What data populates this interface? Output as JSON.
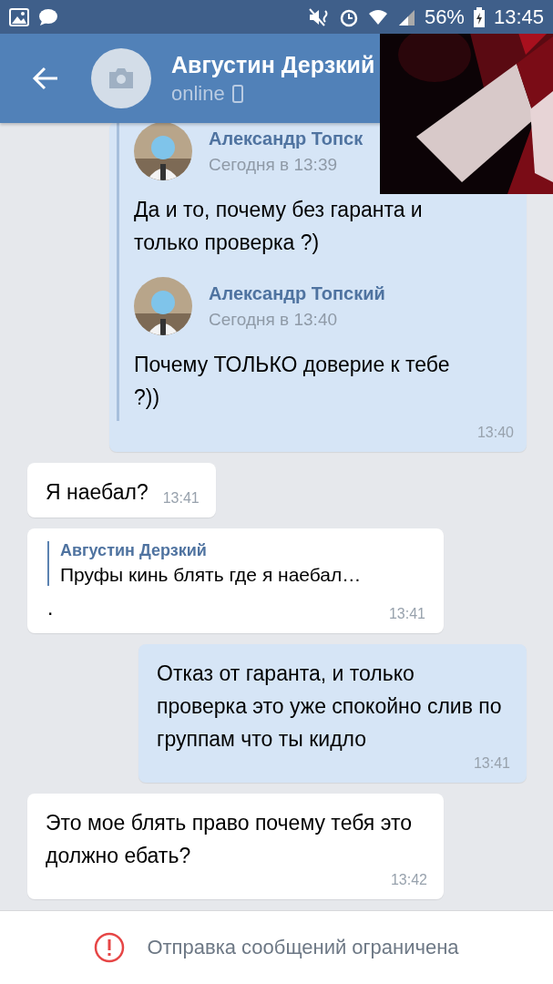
{
  "status_bar": {
    "battery": "56%",
    "time": "13:45"
  },
  "header": {
    "title": "Августин Дерзкий",
    "subtitle": "online"
  },
  "messages": [
    {
      "kind": "forwarded",
      "outgoing": true,
      "forwarded": [
        {
          "author": "Александр Топск",
          "date": "Сегодня в 13:39",
          "text": "Да и то, почему без гаранта и только проверка ?)"
        },
        {
          "author": "Александр Топский",
          "date": "Сегодня в 13:40",
          "text": "Почему ТОЛЬКО доверие к тебе ?))"
        }
      ],
      "time": "13:40"
    },
    {
      "kind": "text",
      "outgoing": false,
      "text": "Я наебал?",
      "time": "13:41"
    },
    {
      "kind": "reply",
      "outgoing": false,
      "reply": {
        "author": "Августин Дерзкий",
        "text": "Пруфы кинь блять где я наебал…"
      },
      "text": ".",
      "time": "13:41"
    },
    {
      "kind": "text",
      "outgoing": true,
      "text": "Отказ от гаранта, и только проверка это уже спокойно слив по группам что ты кидло",
      "time": "13:41"
    },
    {
      "kind": "text",
      "outgoing": false,
      "text": "Это мое блять право почему тебя это должно ебать?",
      "time": "13:42"
    }
  ],
  "notice": {
    "text": "Отправка сообщений ограничена"
  }
}
